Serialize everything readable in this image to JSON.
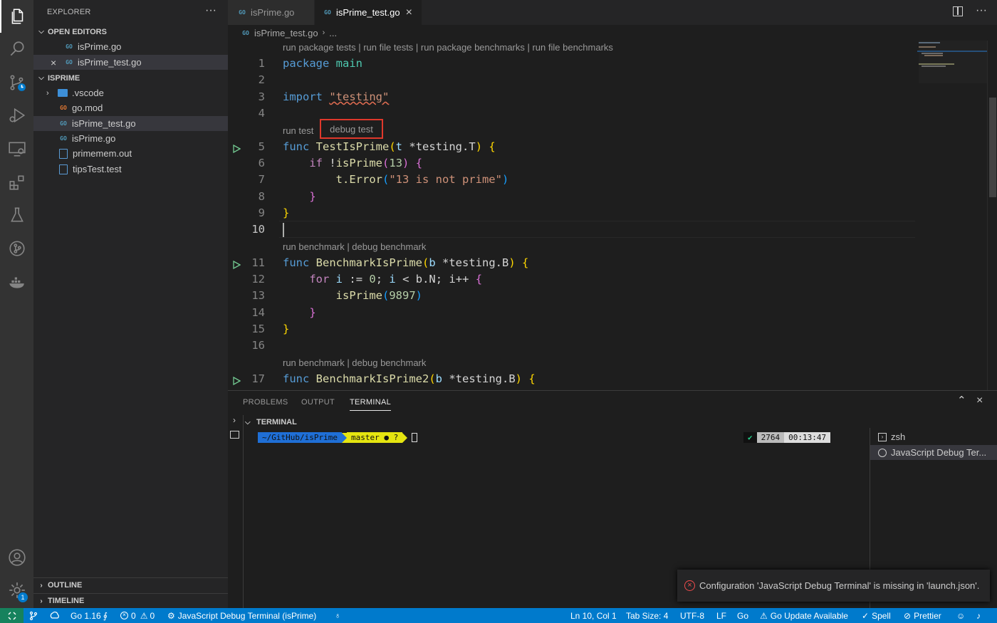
{
  "activity_bar": {
    "items": [
      "files-icon",
      "search-icon",
      "source-control-icon",
      "run-debug-icon",
      "remote-explorer-icon",
      "extensions-icon",
      "testing-icon",
      "git-graph-icon",
      "docker-icon"
    ],
    "bottom": [
      "account-icon",
      "settings-gear-icon"
    ],
    "settings_badge": "1"
  },
  "sidebar": {
    "title": "EXPLORER",
    "more": "···",
    "open_editors": {
      "label": "OPEN EDITORS",
      "items": [
        {
          "name": "isPrime.go"
        },
        {
          "name": "isPrime_test.go"
        }
      ]
    },
    "project": {
      "label": "ISPRIME",
      "items": [
        {
          "name": ".vscode"
        },
        {
          "name": "go.mod"
        },
        {
          "name": "isPrime_test.go"
        },
        {
          "name": "isPrime.go"
        },
        {
          "name": "primemem.out"
        },
        {
          "name": "tipsTest.test"
        }
      ]
    },
    "outline_label": "OUTLINE",
    "timeline_label": "TIMELINE"
  },
  "tabs": [
    {
      "label": "isPrime.go",
      "active": false
    },
    {
      "label": "isPrime_test.go",
      "active": true
    }
  ],
  "tab_close": "×",
  "editor_actions_more": "···",
  "breadcrumb": {
    "file": "isPrime_test.go",
    "rest": "..."
  },
  "editor": {
    "codelens_top": "run package tests | run file tests | run package benchmarks | run file benchmarks",
    "codelens_test": {
      "run": "run test",
      "debug": "debug test"
    },
    "codelens_bench1": "run benchmark | debug benchmark",
    "codelens_bench2": "run benchmark | debug benchmark",
    "line_numbers": [
      "1",
      "2",
      "3",
      "4",
      "5",
      "6",
      "7",
      "8",
      "9",
      "10",
      "11",
      "12",
      "13",
      "14",
      "15",
      "16",
      "17"
    ],
    "tokens": {
      "package": "package",
      "main": "main",
      "import": "import",
      "testing_str": "\"testing\"",
      "func": "func",
      "TestIsPrime": "TestIsPrime",
      "t": "t",
      "testing_T": "*testing.T",
      "if": "if",
      "not": "!",
      "isPrime": "isPrime",
      "n13": "13",
      "tError": "t.Error",
      "msg": "\"13 is not prime\"",
      "BenchmarkIsPrime": "BenchmarkIsPrime",
      "b": "b",
      "testing_B": "*testing.B",
      "for": "for",
      "i": "i",
      "assign": ":=",
      "zero": "0",
      "lt": "<",
      "bN": "b.N",
      "ipp": "i++",
      "n9897": "9897",
      "BenchmarkIsPrime2": "BenchmarkIsPrime2"
    }
  },
  "panel": {
    "tabs": [
      "PROBLEMS",
      "OUTPUT",
      "TERMINAL"
    ],
    "active_tab": "TERMINAL",
    "section": "TERMINAL",
    "prompt": {
      "path": "~/GitHub/isPrime",
      "branch": "master ● ?",
      "check": "✔",
      "count": "2764",
      "time": "00:13:47"
    },
    "terminals": [
      "zsh",
      "JavaScript Debug Ter..."
    ]
  },
  "notification": "Configuration 'JavaScript Debug Terminal' is missing in 'launch.json'.",
  "status_bar": {
    "go_version": "Go 1.16",
    "errors": "0",
    "warnings": "0",
    "debug_session": "JavaScript Debug Terminal (isPrime)",
    "position": "Ln 10, Col 1",
    "tab_size": "Tab Size: 4",
    "encoding": "UTF-8",
    "eol": "LF",
    "language": "Go",
    "update": "Go Update Available",
    "spell": "Spell",
    "prettier": "Prettier"
  },
  "colors": {
    "accent": "#007acc",
    "highlight_box": "#e0382b",
    "prompt_blue": "#1f6fd6",
    "prompt_yellow": "#e5e510"
  }
}
